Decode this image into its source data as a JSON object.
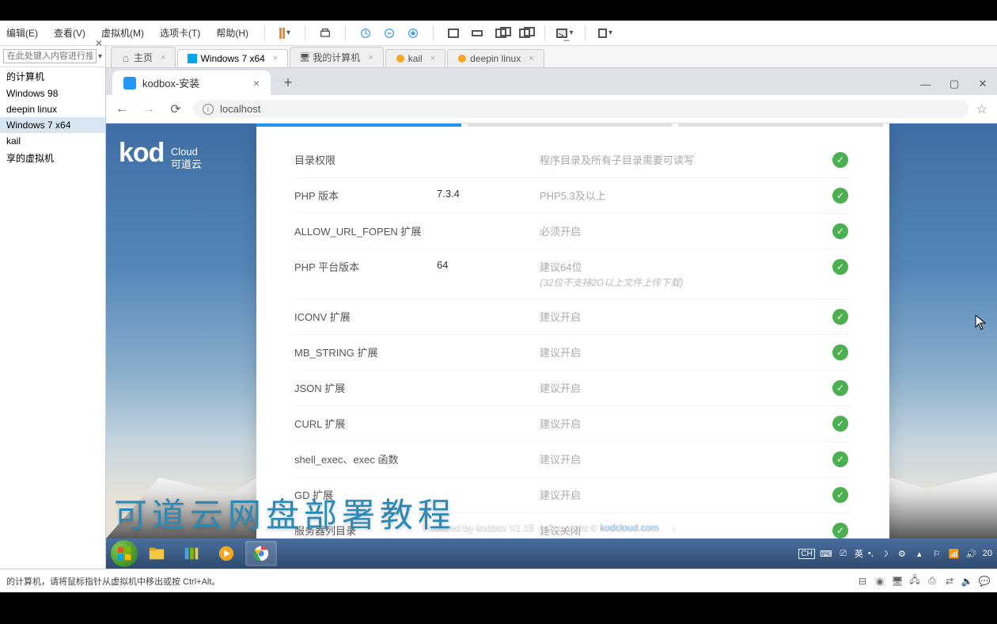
{
  "host": {
    "menu": [
      "编辑(E)",
      "查看(V)",
      "虚拟机(M)",
      "选项卡(T)",
      "帮助(H)"
    ],
    "sidebar": {
      "search_placeholder": "在此处键入内容进行搜索",
      "vms": [
        "的计算机",
        "Windows 98",
        "deepin linux",
        "Windows 7 x64",
        "kail",
        "享的虚拟机"
      ],
      "selected_index": 3
    },
    "vm_tabs": [
      {
        "label": "主页",
        "icon": "home"
      },
      {
        "label": "Windows 7 x64",
        "icon": "win",
        "active": true
      },
      {
        "label": "我的计算机",
        "icon": "mon"
      },
      {
        "label": "kail",
        "icon": "lin"
      },
      {
        "label": "deepin linux",
        "icon": "lin"
      }
    ],
    "status": "的计算机，请将鼠标指针从虚拟机中移出或按 Ctrl+Alt。"
  },
  "chrome": {
    "tab_title": "kodbox-安装",
    "url": "localhost"
  },
  "kod": {
    "logo_main": "kod",
    "logo_sub1": "Cloud",
    "logo_sub2": "可道云",
    "footer_powered": "Powered by kodbox V1.15",
    "footer_copy": "Copyright © ",
    "footer_link": "kodcloud.com",
    "checks": [
      {
        "name": "目录权限",
        "value": "",
        "desc": "程序目录及所有子目录需要可读写",
        "sub": ""
      },
      {
        "name": "PHP 版本",
        "value": "7.3.4",
        "desc": "PHP5.3及以上",
        "sub": ""
      },
      {
        "name": "ALLOW_URL_FOPEN 扩展",
        "value": "",
        "desc": "必须开启",
        "sub": ""
      },
      {
        "name": "PHP 平台版本",
        "value": "64",
        "desc": "建议64位",
        "sub": "(32位不支持2G以上文件上传下载)"
      },
      {
        "name": "ICONV 扩展",
        "value": "",
        "desc": "建议开启",
        "sub": ""
      },
      {
        "name": "MB_STRING 扩展",
        "value": "",
        "desc": "建议开启",
        "sub": ""
      },
      {
        "name": "JSON 扩展",
        "value": "",
        "desc": "建议开启",
        "sub": ""
      },
      {
        "name": "CURL 扩展",
        "value": "",
        "desc": "建议开启",
        "sub": ""
      },
      {
        "name": "shell_exec、exec 函数",
        "value": "",
        "desc": "建议开启",
        "sub": ""
      },
      {
        "name": "GD 扩展",
        "value": "",
        "desc": "建议开启",
        "sub": ""
      },
      {
        "name": "服务器列目录",
        "value": "",
        "desc": "建议关闭",
        "sub": ""
      }
    ]
  },
  "overlay": {
    "subtitle": "可道云网盘部署教程"
  },
  "taskbar": {
    "lang": "英",
    "time_segment": "20"
  },
  "colors": {
    "accent_blue": "#2196f3",
    "ok_green": "#4caf50"
  }
}
